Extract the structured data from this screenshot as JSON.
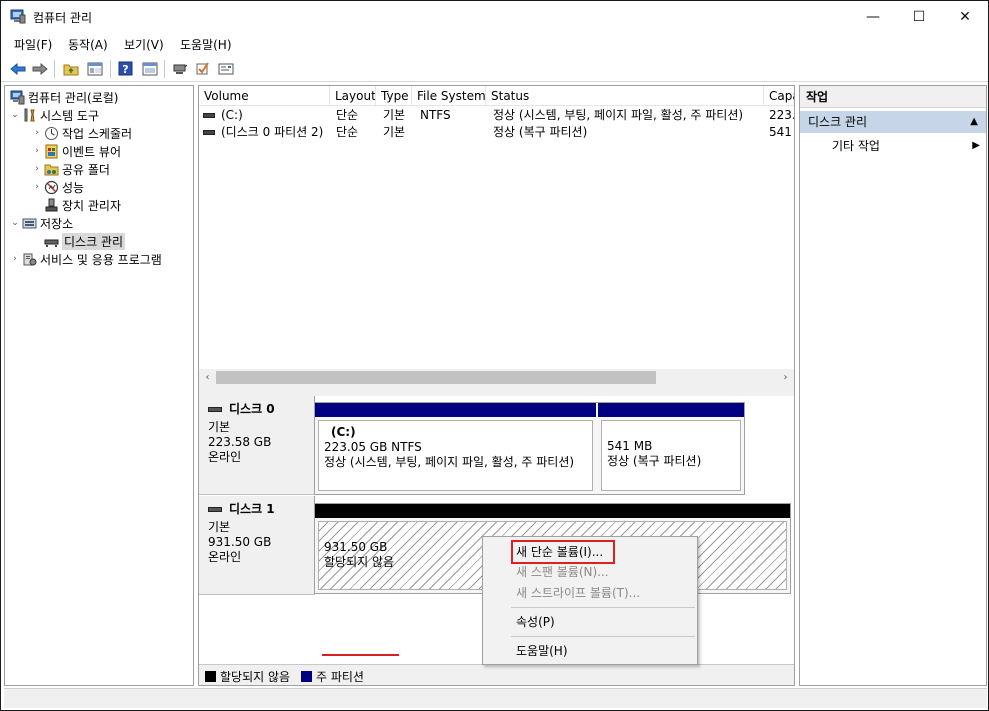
{
  "window": {
    "title": "컴퓨터 관리",
    "minimize_glyph": "—",
    "maximize_glyph": "☐",
    "close_glyph": "✕"
  },
  "menu": [
    "파일(F)",
    "동작(A)",
    "보기(V)",
    "도움말(H)"
  ],
  "toolbar": {
    "icons": [
      "back-arrow-icon",
      "forward-arrow-icon",
      "up-folder-icon",
      "show-hide-tree-icon",
      "help-icon",
      "properties-icon",
      "connect-icon",
      "check-icon",
      "console-icon"
    ]
  },
  "tree": {
    "root": "컴퓨터 관리(로컬)",
    "system_tools": "시스템 도구",
    "task_scheduler": "작업 스케줄러",
    "event_viewer": "이벤트 뷰어",
    "shared_folders": "공유 폴더",
    "performance": "성능",
    "device_manager": "장치 관리자",
    "storage": "저장소",
    "disk_management": "디스크 관리",
    "services_apps": "서비스 및 응용 프로그램"
  },
  "volumes": {
    "headers": [
      "Volume",
      "Layout",
      "Type",
      "File System",
      "Status",
      "Capa"
    ],
    "rows": [
      {
        "volume": "(C:)",
        "layout": "단순",
        "type": "기본",
        "fs": "NTFS",
        "status": "정상 (시스템, 부팅, 페이지 파일, 활성, 주 파티션)",
        "cap": "223."
      },
      {
        "volume": "(디스크 0 파티션 2)",
        "layout": "단순",
        "type": "기본",
        "fs": "",
        "status": "정상 (복구 파티션)",
        "cap": "541"
      }
    ],
    "scroll_left": "‹",
    "scroll_right": "›"
  },
  "disks": [
    {
      "name": "디스크 0",
      "kind": "기본",
      "size": "223.58 GB",
      "state": "온라인",
      "partitions": [
        {
          "title": "(C:)",
          "line1": "223.05 GB NTFS",
          "line2": "정상 (시스템, 부팅, 페이지 파일, 활성, 주 파티션)"
        },
        {
          "title": "",
          "line1": "541 MB",
          "line2": "정상 (복구 파티션)"
        }
      ]
    },
    {
      "name": "디스크 1",
      "kind": "기본",
      "size": "931.50 GB",
      "state": "온라인",
      "partitions": [
        {
          "title": "",
          "line1": "931.50 GB",
          "line2": "할당되지 않음"
        }
      ]
    }
  ],
  "legend": {
    "unallocated": "할당되지 않음",
    "primary": "주 파티션",
    "colors": {
      "unallocated": "#000000",
      "primary": "#000080"
    }
  },
  "actions": {
    "header": "작업",
    "section": "디스크 관리",
    "section_arrow": "▲",
    "more": "기타 작업",
    "more_arrow": "▶"
  },
  "context_menu": {
    "new_simple": "새 단순 볼륨(I)...",
    "new_spanned": "새 스팬 볼륨(N)...",
    "new_striped": "새 스트라이프 볼륨(T)...",
    "properties": "속성(P)",
    "help": "도움말(H)"
  }
}
